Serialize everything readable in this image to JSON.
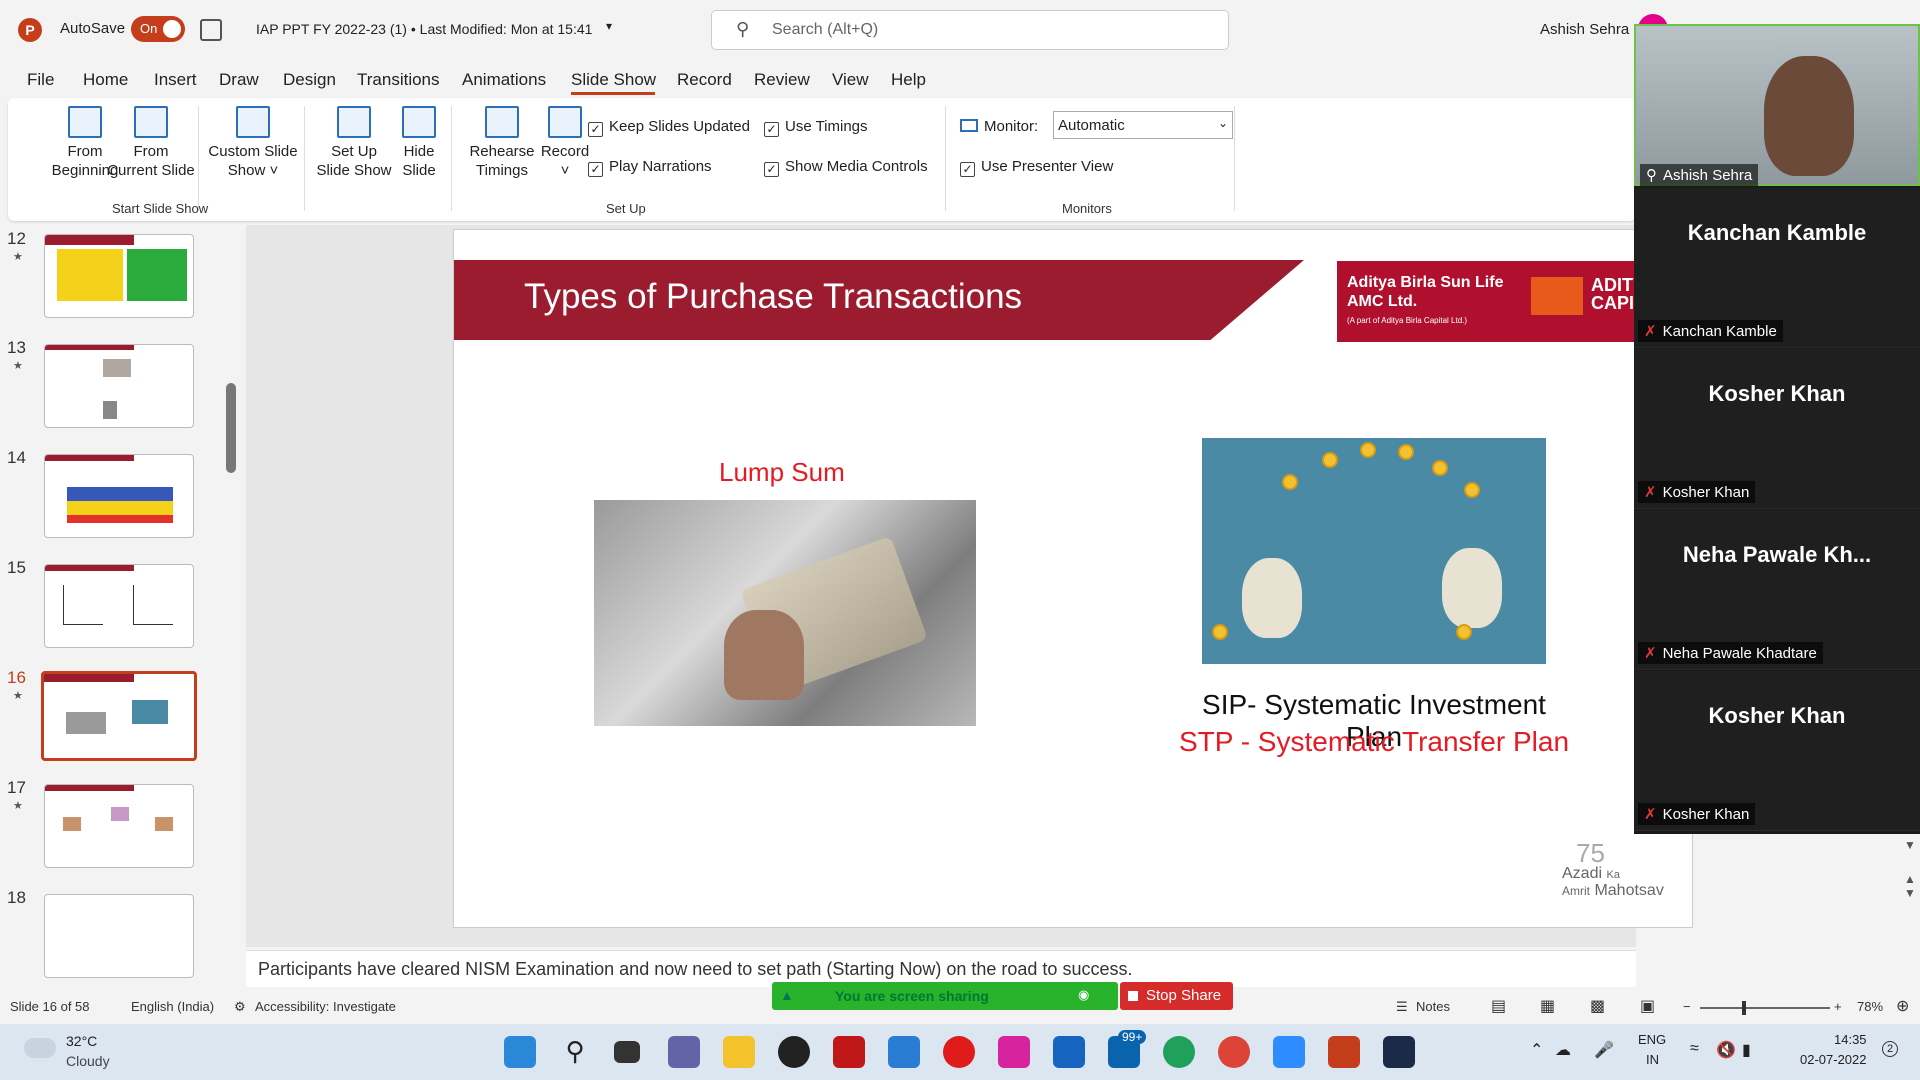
{
  "titlebar": {
    "autosave_label": "AutoSave",
    "autosave_state": "On",
    "doc_title": "IAP PPT FY 2022-23 (1) • Last Modified: Mon at 15:41",
    "search_placeholder": "Search (Alt+Q)",
    "user_name": "Ashish Sehra"
  },
  "menu": {
    "tabs": [
      "File",
      "Home",
      "Insert",
      "Draw",
      "Design",
      "Transitions",
      "Animations",
      "Slide Show",
      "Record",
      "Review",
      "View",
      "Help"
    ],
    "active": "Slide Show"
  },
  "ribbon": {
    "from_beginning": [
      "From",
      "Beginning"
    ],
    "from_current": [
      "From",
      "Current Slide"
    ],
    "custom_show": [
      "Custom Slide",
      "Show ˅"
    ],
    "group_start": "Start Slide Show",
    "set_up_show": [
      "Set Up",
      "Slide Show"
    ],
    "hide_slide": [
      "Hide",
      "Slide"
    ],
    "rehearse": [
      "Rehearse",
      "Timings"
    ],
    "record": [
      "Record",
      "˅"
    ],
    "keep_updated": "Keep Slides Updated",
    "play_narrations": "Play Narrations",
    "use_timings": "Use Timings",
    "show_media": "Show Media Controls",
    "group_setup": "Set Up",
    "monitor_label": "Monitor:",
    "monitor_value": "Automatic",
    "presenter_view": "Use Presenter View",
    "group_monitors": "Monitors"
  },
  "thumbnails": [
    {
      "num": "12"
    },
    {
      "num": "13"
    },
    {
      "num": "14"
    },
    {
      "num": "15"
    },
    {
      "num": "16"
    },
    {
      "num": "17"
    },
    {
      "num": "18"
    }
  ],
  "slide": {
    "title": "Types of Purchase Transactions",
    "brand_line1": "Aditya Birla Sun Life",
    "brand_line2": "AMC Ltd.",
    "brand_sub": "(A part of Aditya Birla Capital Ltd.)",
    "brand_cap1": "ADITYA",
    "brand_cap2": "CAPI",
    "lump_sum": "Lump Sum",
    "sip": "SIP- Systematic Investment Plan",
    "stp": "STP - Systematic Transfer Plan",
    "azadi1": "Azadi",
    "azadi2": "Ka",
    "azadi3": "Amrit",
    "azadi4": "Mahotsav"
  },
  "notes": "Participants have cleared NISM Examination and now need to set path (Starting Now) on the road to success.",
  "zoom": {
    "self_label": "Ashish Sehra",
    "participants": [
      {
        "big": "Kanchan Kamble",
        "label": "Kanchan Kamble"
      },
      {
        "big": "Kosher Khan",
        "label": "Kosher Khan"
      },
      {
        "big": "Neha  Pawale  Kh...",
        "label": "Neha Pawale Khadtare"
      },
      {
        "big": "Kosher Khan",
        "label": "Kosher Khan"
      }
    ]
  },
  "status": {
    "slide_count": "Slide 16 of 58",
    "language": "English (India)",
    "accessibility": "Accessibility: Investigate",
    "notes_btn": "Notes",
    "zoom_level": "78%",
    "sharing": "You are screen sharing",
    "stop_share": "Stop Share"
  },
  "taskbar": {
    "temp": "32°C",
    "condition": "Cloudy",
    "lang1": "ENG",
    "lang2": "IN",
    "time": "14:35",
    "date": "02-07-2022",
    "notif_badge": "99+",
    "notif_count": "2"
  }
}
